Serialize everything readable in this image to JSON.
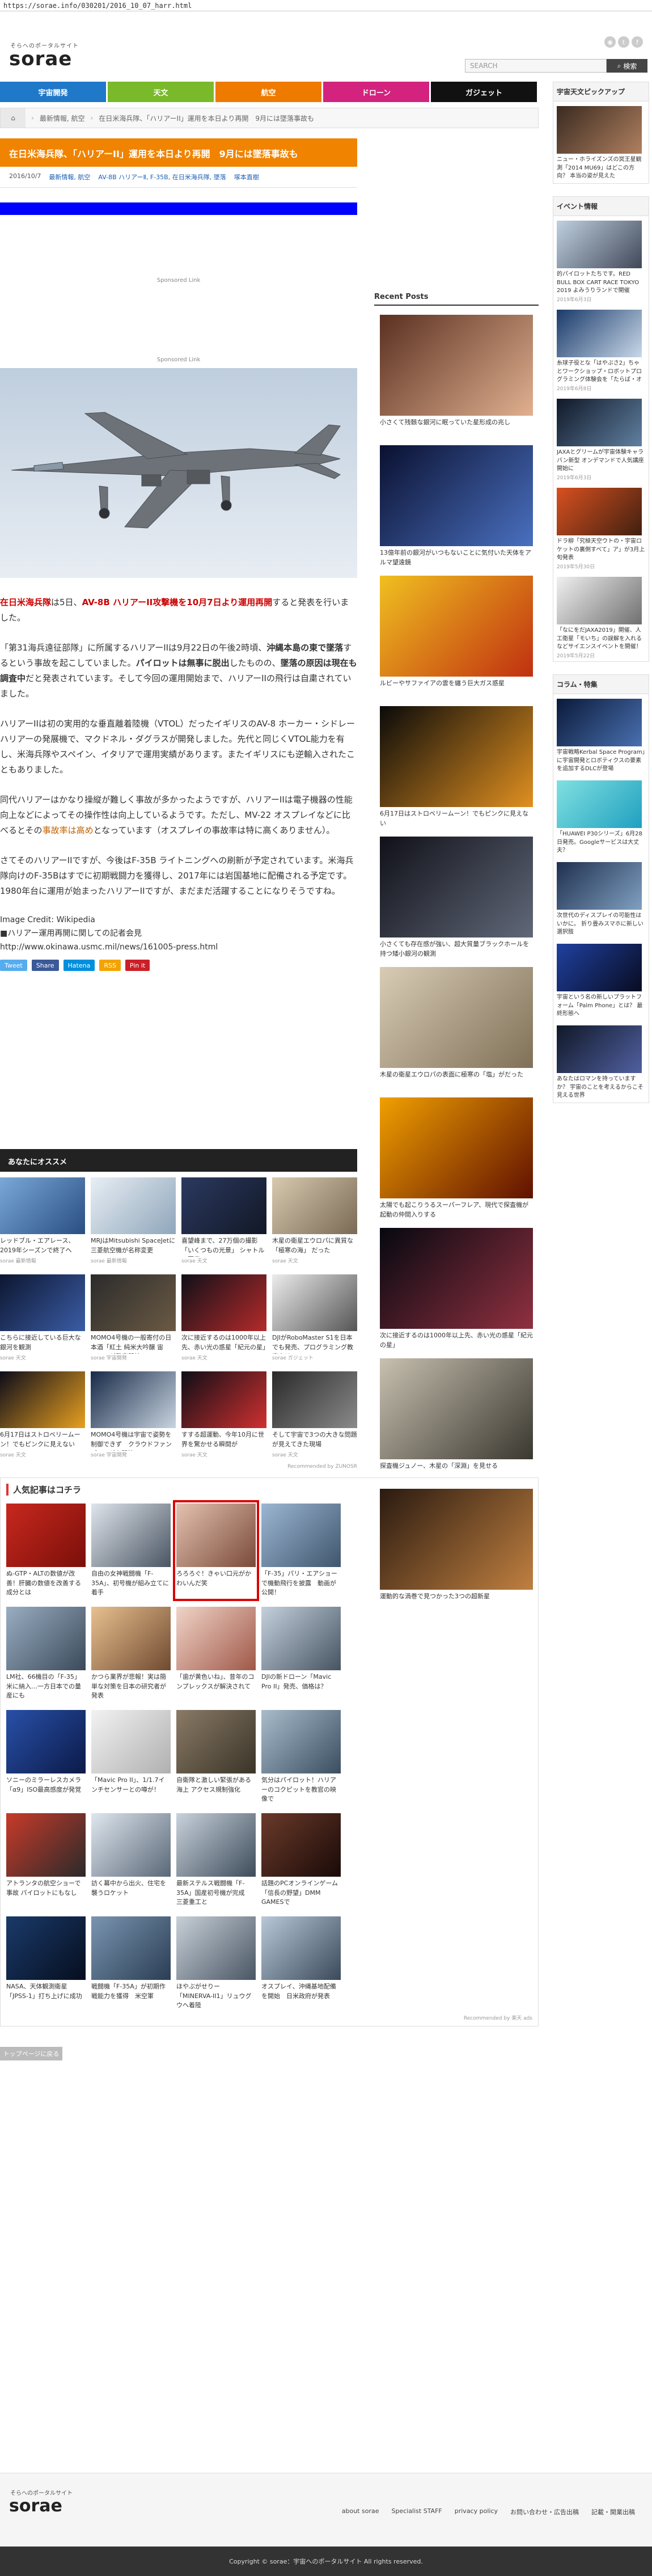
{
  "browser": {
    "url": "https://sorae.info/030201/2016_10_07_harr.html"
  },
  "header": {
    "logo_sub": "そらへのポータルサイト",
    "logo": "sorae",
    "social": [
      "rss",
      "twitter",
      "facebook"
    ],
    "search_placeholder": "SEARCH",
    "search_button": "検索"
  },
  "nav": [
    {
      "label": "宇宙開発",
      "color": "#1f78c8"
    },
    {
      "label": "天文",
      "color": "#7ab929"
    },
    {
      "label": "航空",
      "color": "#ee7a00"
    },
    {
      "label": "ドローン",
      "color": "#d3237e"
    },
    {
      "label": "ガジェット",
      "color": "#111111"
    }
  ],
  "breadcrumb": [
    "最新情報, 航空",
    "在日米海兵隊、「ハリアーII」運用を本日より再開　9月には墜落事故も"
  ],
  "article": {
    "title": "在日米海兵隊、「ハリアーII」運用を本日より再開　9月には墜落事故も",
    "date": "2016/10/7",
    "category": "最新情報, 航空",
    "tags": "AV-8B ハリアーⅡ, F-35B, 在日米海兵隊, 墜落",
    "author": "塚本直樹",
    "sponsored": "Sponsored Link",
    "p1_a": "在日米海兵隊",
    "p1_b": "は5日、",
    "p1_c": "AV-8B ハリアーII攻撃機を10月7日より運用再開",
    "p1_d": "すると発表を行いました。",
    "p2": "「第31海兵遠征部隊」に所属するハリアーIIは9月22日の午後2時頃、沖縄本島の東で墜落するという事故を起こしていました。パイロットは無事に脱出したものの、空last墜落の原因は現在も調査中だと発表されています。そして今回の運用開始まで、ハリアーIIの飛行は自粛されていました。",
    "p2_a": "「第31海兵遠征部隊」に所属するハリアーIIは9月22日の午後2時頃、",
    "p2_b": "沖縄本島の東で墜落",
    "p2_c": "するという事故を起こしていました。",
    "p2_d": "パイロットは無事に脱出",
    "p2_e": "したものの、",
    "p2_f": "墜落の原因は現在も調査中",
    "p2_g": "だと発表されています。そして今回の運用開始まで、ハリアーIIの飛行は自粛されていました。",
    "p3_a": "ハリアーIIは初の実用的な垂直離着陸機（VTOL）だったイギリスのAV-8 ホーカー・シドレー ハリアーの発展機で、マクドネル・ダグラスが開発しました。先代と同じくVTOL能力を有し、米海兵隊やスペイン、イタリアで運用実績があります。またイギリスにも逆輸入されたこともありました。",
    "p4_a": "同代ハリアーはかなり操縦が難しく事故が多かったようですが、ハリアーIIは電子機器の性能向上などによってその操作性は向上しているようです。ただし、MV-22 オスプレイなどに比べるとその",
    "p4_link": "事故率は高め",
    "p4_b": "となっています（オスプレイの事故率は特に高くありません）。",
    "p5": "さてそのハリアーIIですが、今後はF-35B ライトニングへの刷新が予定されています。米海兵隊向けのF-35Bはすでに初期戦闘力を獲得し、2017年には岩国基地に配備される予定です。1980年台に運用が始まったハリアーIIですが、まだまだ活躍することになりそうですね。",
    "credit_label": "Image Credit: Wikipedia",
    "source_line": "■ハリアー運用再開に関しての記者会見",
    "source_url": "http://www.okinawa.usmc.mil/news/161005-press.html",
    "share": [
      {
        "label": "Tweet",
        "color": "#55acee"
      },
      {
        "label": "Share",
        "color": "#3b5998"
      },
      {
        "label": "Hatena",
        "color": "#008fde"
      },
      {
        "label": "RSS",
        "color": "#f4a300"
      },
      {
        "label": "Pin it",
        "color": "#cb2027"
      }
    ]
  },
  "recommend": {
    "title": "あなたにオススメ",
    "items": [
      {
        "text": "レッドブル・エアレース、2019年シーズンで終了へ",
        "src": "sorae 最新情報",
        "colors": [
          "#7aa8d8",
          "#2a4e82"
        ]
      },
      {
        "text": "MRJはMitsubishi SpaceJetに 三菱航空機が名称変更",
        "src": "sorae 最新情報",
        "colors": [
          "#e8eef4",
          "#8fa6bb"
        ]
      },
      {
        "text": "喜望峰まで、27万個の撮影「いくつもの光景」 シャトルの写真",
        "src": "sorae 天文",
        "colors": [
          "#2b3960",
          "#121826"
        ]
      },
      {
        "text": "木星の衛星エウロパに異質な「極寒の海」 だった",
        "src": "sorae 天文",
        "colors": [
          "#d8c9b0",
          "#7a6a55"
        ]
      },
      {
        "text": "こちらに接近している巨大な銀河を観測",
        "src": "sorae 天文",
        "colors": [
          "#0c1630",
          "#3b5da6"
        ]
      },
      {
        "text": "MOMO4号機の一般寄付の日本酒「紅土 純米大吟醸 宙へ！」が発売開始",
        "src": "sorae 宇宙開発",
        "colors": [
          "#2b2b2b",
          "#6b5a44"
        ]
      },
      {
        "text": "次に接近するのは1000年以上先、赤い光の惑星「紀元の星」",
        "src": "sorae 天文",
        "colors": [
          "#101018",
          "#b52a2a"
        ]
      },
      {
        "text": "DJIがRoboMaster S1を日本でも発売、プログラミング教育向け",
        "src": "sorae ガジェット",
        "colors": [
          "#ececec",
          "#555555"
        ]
      },
      {
        "text": "6月17日はストロベリームーン！でもピンクに見えない",
        "src": "sorae 天文",
        "colors": [
          "#0c0c1a",
          "#e8a020"
        ]
      },
      {
        "text": "MOMO4号機は宇宙で姿勢を制御できず　クラウドファンディングも開始",
        "src": "sorae 宇宙開発",
        "colors": [
          "#182a48",
          "#c8d4e0"
        ]
      },
      {
        "text": "すする超運動、今年10月に世界を驚かせる瞬間が",
        "src": "sorae 天文",
        "colors": [
          "#0e0e16",
          "#d03030"
        ]
      },
      {
        "text": "そして宇宙で3つの大きな問題が見えてきた現場",
        "src": "sorae 天文",
        "colors": [
          "#2a2a2a",
          "#8a8a8a"
        ]
      }
    ],
    "footer": "Recommended by ZUNOSR"
  },
  "popular": {
    "title": "人気記事はコチラ",
    "items": [
      {
        "text": "ぬ-GTP・ALTの数値が改善！肝臓の数値を改善する成分とは",
        "colors": [
          "#c8281e",
          "#7a0f0a"
        ]
      },
      {
        "text": "自由の女神戦闘機「F-35A」、初号機が組み立てに着手",
        "colors": [
          "#dfe5ec",
          "#4a5562"
        ]
      },
      {
        "text": "ろろろぐ！きゃい口元がかわいんだ笑",
        "colors": [
          "#e4c2b0",
          "#7a4a3a"
        ]
      },
      {
        "text": "「F-35」パリ・エアショーで機動飛行を披露　動画が公開！",
        "colors": [
          "#9cb6d2",
          "#40566e"
        ]
      },
      {
        "text": "",
        "colors": [
          "#ffffff",
          "#ffffff"
        ]
      },
      {
        "text": "LM社、66機目の「F-35」米に納入…一方日本での量産にも",
        "colors": [
          "#9aaec2",
          "#3a4a5a"
        ]
      },
      {
        "text": "かつら業界が悲報！実は簡単な対策を日本の研究者が発表",
        "colors": [
          "#e8c090",
          "#704a30"
        ]
      },
      {
        "text": "「歯が黄色いね」、昔年のコンプレックスが解決されて",
        "colors": [
          "#f0d4c8",
          "#a05848"
        ]
      },
      {
        "text": "DJIの新ドローン「Mavic Pro II」発売、価格は？",
        "colors": [
          "#c4d0dc",
          "#465462"
        ]
      },
      {
        "text": "",
        "colors": [
          "#ffffff",
          "#ffffff"
        ]
      },
      {
        "text": "ソニーのミラーレスカメラ「α9」ISO最高感度が発覚",
        "colors": [
          "#2850a8",
          "#0c1a48"
        ]
      },
      {
        "text": "「Mavic Pro II」、1/1.7インチセンサーとの噂が！",
        "colors": [
          "#f2f2f2",
          "#b0b0b0"
        ]
      },
      {
        "text": "自衛隊と激しい緊張がある海上 アクセス規制強化",
        "colors": [
          "#8a7a66",
          "#3a3428"
        ]
      },
      {
        "text": "気分はパイロット！ハリアーのコクピットを教官の映像で",
        "colors": [
          "#a8bccc",
          "#3a4e60"
        ]
      },
      {
        "text": "",
        "colors": [
          "#ffffff",
          "#ffffff"
        ]
      },
      {
        "text": "アトランタの航空ショーで事故 パイロットにもなし",
        "colors": [
          "#c83a2a",
          "#2a2a2a"
        ]
      },
      {
        "text": "訪く幕中から出火、住宅を襲うロケット",
        "colors": [
          "#dfe6ee",
          "#5a6878"
        ]
      },
      {
        "text": "最新ステルス戦闘機「F-35A」国産初号機が完成　三菱重工と",
        "colors": [
          "#c8d2dc",
          "#3e4c5a"
        ]
      },
      {
        "text": "話題のPCオンラインゲーム「信長の野望」DMM GAMESで",
        "colors": [
          "#6a3a2a",
          "#1a0a08"
        ]
      },
      {
        "text": "",
        "colors": [
          "#ffffff",
          "#ffffff"
        ]
      },
      {
        "text": "NASA、天体観測衛星「JPSS-1」打ち上げに成功",
        "colors": [
          "#1a3a6a",
          "#060e1e"
        ]
      },
      {
        "text": "戦闘機「F-35A」が初期作戦能力を獲得　米空軍",
        "colors": [
          "#7a94b0",
          "#2a3e54"
        ]
      },
      {
        "text": "ほやぶがせりー「MINERVA-II1」リュウグウへ着陸",
        "colors": [
          "#c8d0d8",
          "#4a5664"
        ]
      },
      {
        "text": "オスプレイ、沖縄基地配備を開始　日米政府が発表",
        "colors": [
          "#b8c8d8",
          "#3a4a5a"
        ]
      },
      {
        "text": "",
        "colors": [
          "#ffffff",
          "#ffffff"
        ]
      }
    ],
    "footer": "Recommended by 楽天 ads"
  },
  "top_button": "トップページに戻る",
  "recent": {
    "title": "Recent Posts",
    "items": [
      {
        "text": "小さくて残骸な銀河に眠っていた星形成の兆し",
        "colors": [
          "#5a3020",
          "#e0b090"
        ]
      },
      {
        "text": "13億年前の銀河がいつもないことに気付いた天体をアルマ望遠鏡",
        "colors": [
          "#0a1030",
          "#4a70c0"
        ]
      },
      {
        "text": "ルビーやサファイアの雲を纏う巨大ガス惑星",
        "colors": [
          "#f0c020",
          "#c03010"
        ]
      },
      {
        "text": "6月17日はストロベリームーン！でもピンクに見えない",
        "colors": [
          "#0a0a0a",
          "#e09020"
        ]
      },
      {
        "text": "小さくても存在感が強い、超大質量ブラックホールを持つ矮小銀河の観測",
        "colors": [
          "#101018",
          "#606878"
        ]
      },
      {
        "text": "木星の衛星エウロパの表面に極寒の「塩」がだった",
        "colors": [
          "#d8ccb4",
          "#807058"
        ]
      },
      {
        "text": "太陽でも起こりうるスーパーフレア、現代で探査機が起動の仲間入りする",
        "colors": [
          "#f0a000",
          "#601000"
        ]
      },
      {
        "text": "次に接近するのは1000年以上先、赤い光の惑星「紀元の星」",
        "colors": [
          "#060810",
          "#903040"
        ]
      },
      {
        "text": "探査機ジュノー、木星の「深淵」を見せる",
        "colors": [
          "#c8c0b0",
          "#3a3830"
        ]
      },
      {
        "text": "運動的な渦巻で見つかった3つの超新星",
        "colors": [
          "#2a1a10",
          "#c08040"
        ]
      }
    ]
  },
  "sidebar": {
    "pickup": {
      "title": "宇宙天文ピックアップ",
      "items": [
        {
          "text": "ニュー・ホライズンズの冥王星観測「2014 MU69」はどこの方向？ 本当の姿が見えた",
          "date": "",
          "colors": [
            "#3a2a20",
            "#b08060"
          ]
        }
      ]
    },
    "events": {
      "title": "イベント情報",
      "items": [
        {
          "text": "的パイロットたちです。RED BULL BOX CART RACE TOKYO 2019 よみうりランドで開催",
          "date": "2019年6月3日",
          "colors": [
            "#c0d0e0",
            "#404858"
          ]
        },
        {
          "text": "糸球子役とな「はやぶさ2」ちゃとワークショップ・ロボットプログラミング体験会を「たらば・オ開拓の」 宇宙で好紅",
          "date": "2019年6月8日",
          "colors": [
            "#1a3a6a",
            "#c8d8e8"
          ]
        },
        {
          "text": "JAXAとグリームが宇宙体験キャラバン新型 オンデマンドで人気講座開始に",
          "date": "2019年6月3日",
          "colors": [
            "#101828",
            "#6080a0"
          ]
        },
        {
          "text": "ドラ柳「究極天空ウトの・宇宙ロケットの裏側すべて」ア」が3月上旬発表",
          "date": "2019年5月30日",
          "colors": [
            "#d85020",
            "#402010"
          ]
        },
        {
          "text": "「なにをだJAXA2019」開催、人工衛星「モいち」の誤解を入れるなどサイエンスイベントを開催！",
          "date": "2019年5月22日",
          "colors": [
            "#f0f0f0",
            "#707070"
          ]
        }
      ]
    },
    "column": {
      "title": "コラム・特集",
      "items": [
        {
          "text": "宇宙戦略Kerbal Space Program」に宇宙開発とロボティクスの要素を追加するDLCが登場",
          "date": "",
          "colors": [
            "#0a1a3a",
            "#4a70b0"
          ]
        },
        {
          "text": "「HUAWEI P30シリーズ」6月28日発売。Googleサービスは大丈夫？",
          "date": "",
          "colors": [
            "#80e0e0",
            "#20a0c0"
          ]
        },
        {
          "text": "次世代のディスプレイの可能性はいかに。 折り畳みスマホに新しい選択肢",
          "date": "",
          "colors": [
            "#203050",
            "#80a0c0"
          ]
        },
        {
          "text": "宇宙という名の新しいプラットフォーム「Palm Phone」とは？ 最終形態へ",
          "date": "",
          "colors": [
            "#2040a0",
            "#080c20"
          ]
        },
        {
          "text": "あなたはロマンを持っていますか？ 宇宙のことを考えるからこそ見える世界",
          "date": "",
          "colors": [
            "#101828",
            "#5060a0"
          ]
        }
      ]
    }
  },
  "footer": {
    "logo_sub": "そらへのポータルサイト",
    "logo": "sorae",
    "links": [
      "about sorae",
      "Specialist STAFF",
      "privacy policy",
      "お問い合わせ・広告出稿",
      "記載・開業出稿"
    ],
    "copyright": "Copyright © sorae：宇宙へのポータルサイト All rights reserved."
  }
}
